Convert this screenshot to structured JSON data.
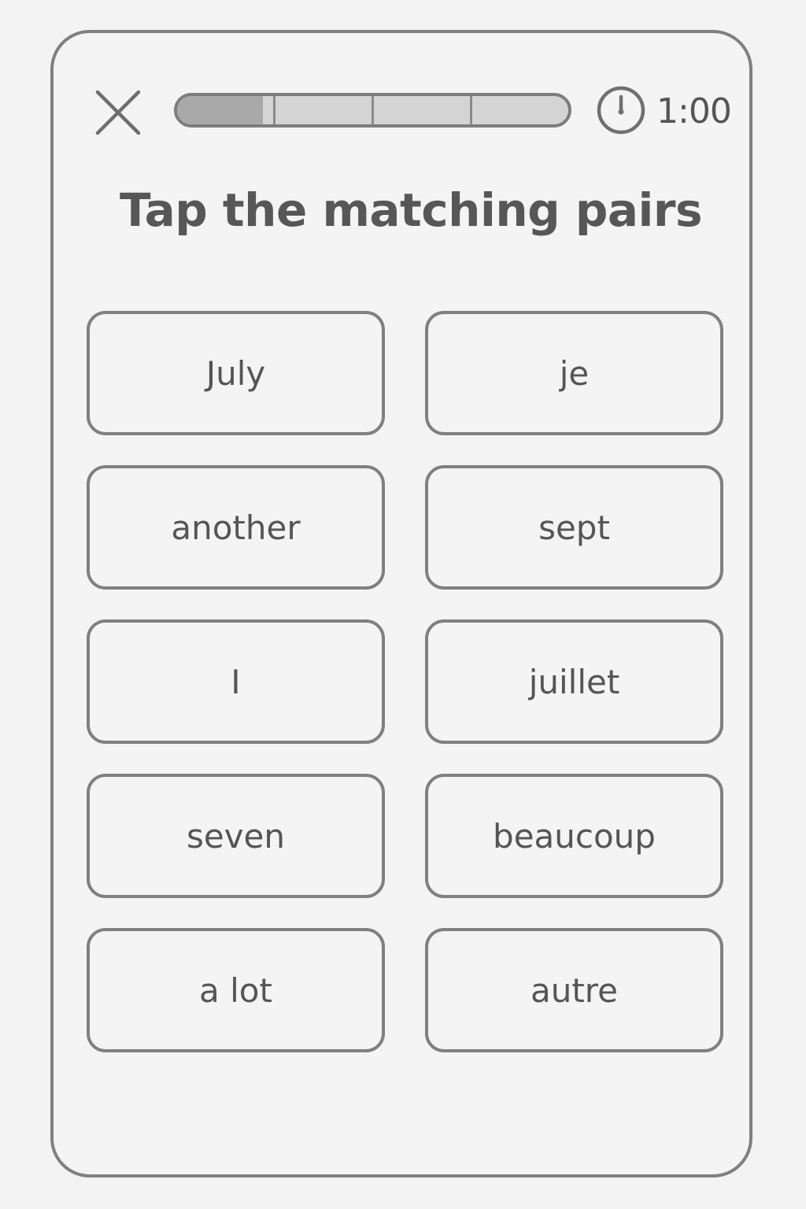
{
  "header": {
    "close_icon": "close-icon",
    "progress": {
      "segments": 4,
      "completed_fraction": 0.22
    },
    "timer": {
      "icon": "clock-icon",
      "value": "1:00"
    }
  },
  "exercise": {
    "title": "Tap the matching pairs",
    "left_words": [
      "July",
      "another",
      "I",
      "seven",
      "a lot"
    ],
    "right_words": [
      "je",
      "sept",
      "juillet",
      "beaucoup",
      "autre"
    ]
  }
}
